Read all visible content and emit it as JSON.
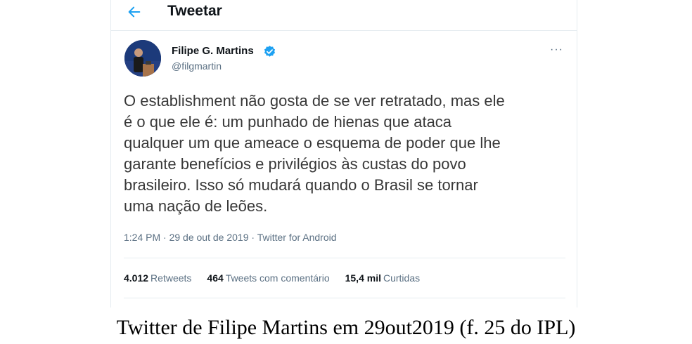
{
  "header": {
    "back_icon": "arrow-left-icon",
    "title": "Tweetar"
  },
  "tweet": {
    "author": {
      "name": "Filipe G. Martins",
      "handle": "@filgmartin",
      "verified_icon": "verified-badge-icon"
    },
    "more_icon": "ellipsis-icon",
    "more_label": "···",
    "text": "O establishment não gosta de se ver retratado, mas ele\né o que ele é: um punhado de hienas que ataca\nqualquer um que ameace o esquema de poder que lhe\ngarante benefícios e privilégios às custas do povo\nbrasileiro. Isso só mudará quando o Brasil se tornar\numa nação de leões.",
    "time": "1:24 PM",
    "separator": "·",
    "date": "29 de out de 2019",
    "source": "Twitter for Android",
    "stats": {
      "retweets_count": "4.012",
      "retweets_label": "Retweets",
      "quotes_count": "464",
      "quotes_label": "Tweets com comentário",
      "likes_count": "15,4 mil",
      "likes_label": "Curtidas"
    }
  },
  "caption": "Twitter de Filipe Martins em 29out2019 (f. 25 do IPL)",
  "colors": {
    "accent": "#1da1f2",
    "secondary_text": "#5b7083",
    "border": "#e6ecf0"
  }
}
